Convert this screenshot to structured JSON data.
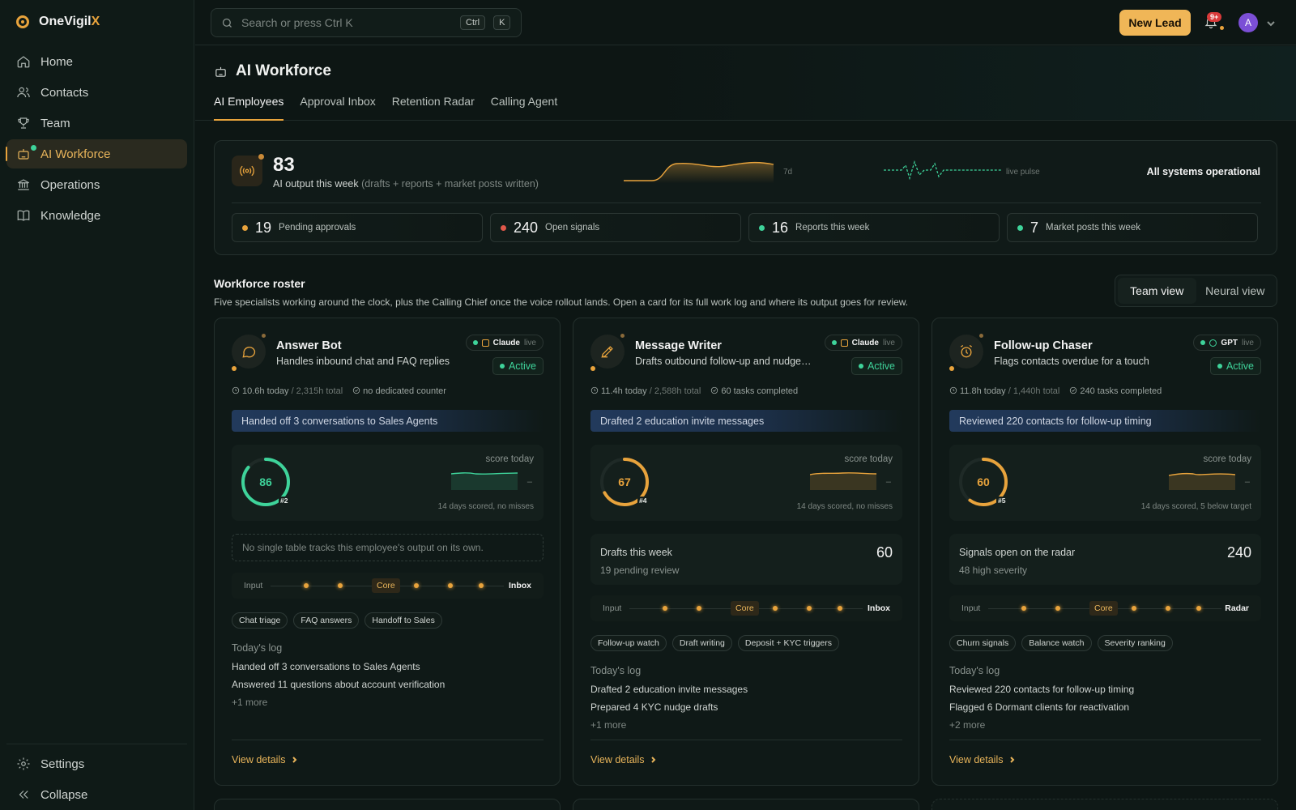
{
  "brand": {
    "name": "OneVigil",
    "suffix": "X",
    "accent": "#e8a33c"
  },
  "sidebar": {
    "items": [
      {
        "label": "Home",
        "icon": "home-icon"
      },
      {
        "label": "Contacts",
        "icon": "users-icon"
      },
      {
        "label": "Team",
        "icon": "trophy-icon"
      },
      {
        "label": "AI Workforce",
        "icon": "robot-icon",
        "active": true
      },
      {
        "label": "Operations",
        "icon": "bank-icon"
      },
      {
        "label": "Knowledge",
        "icon": "book-icon"
      }
    ],
    "bottom": [
      {
        "label": "Settings",
        "icon": "gear-icon"
      },
      {
        "label": "Collapse",
        "icon": "collapse-icon"
      }
    ]
  },
  "topbar": {
    "search_placeholder": "Search or press Ctrl K",
    "kbd1": "Ctrl",
    "kbd2": "K",
    "new_lead": "New Lead",
    "notif_badge": "9+",
    "avatar": "A"
  },
  "page": {
    "title": "AI Workforce",
    "tabs": [
      "AI Employees",
      "Approval Inbox",
      "Retention Radar",
      "Calling Agent"
    ],
    "active_tab": 0
  },
  "stats": {
    "output_value": "83",
    "output_label": "AI output this week",
    "output_note": "(drafts + reports + market posts written)",
    "spark_label": "7d",
    "pulse_label": "live pulse",
    "status": "All systems operational",
    "minis": [
      {
        "value": "19",
        "label": "Pending approvals",
        "color": "#e8a33c"
      },
      {
        "value": "240",
        "label": "Open signals",
        "color": "#e0584a"
      },
      {
        "value": "16",
        "label": "Reports this week",
        "color": "#3ed39a"
      },
      {
        "value": "7",
        "label": "Market posts this week",
        "color": "#3ed39a"
      }
    ]
  },
  "roster": {
    "title": "Workforce roster",
    "subtitle": "Five specialists working around the clock, plus the Calling Chief once the voice rollout lands. Open a card for its full work log and where its output goes for review.",
    "views": [
      "Team view",
      "Neural view"
    ]
  },
  "cards": [
    {
      "name": "Answer Bot",
      "desc": "Handles inbound chat and FAQ replies",
      "icon": "chat-icon",
      "model": "Claude",
      "live": "live",
      "status": "Active",
      "hours": "10.6h today",
      "total": "/ 2,315h total",
      "counter": "no dedicated counter",
      "banner": "Handed off 3 conversations to Sales Agents",
      "score": 86,
      "rank": "#2",
      "score_color": "#3ed39a",
      "score_label": "score today",
      "dash": "–",
      "score_note": "14 days scored, no misses",
      "note": "No single table tracks this employee's output on its own.",
      "flow_in": "Input",
      "flow_core": "Core",
      "flow_out": "Inbox",
      "tags": [
        "Chat triage",
        "FAQ answers",
        "Handoff to Sales"
      ],
      "log_title": "Today's log",
      "log": [
        "Handed off 3 conversations to Sales Agents",
        "Answered 11 questions about account verification"
      ],
      "more": "+1 more",
      "details": "View details"
    },
    {
      "name": "Message Writer",
      "desc": "Drafts outbound follow-up and nudge messages",
      "icon": "pen-icon",
      "model": "Claude",
      "live": "live",
      "status": "Active",
      "hours": "11.4h today",
      "total": "/ 2,588h total",
      "counter": "60 tasks completed",
      "banner": "Drafted 2 education invite messages",
      "score": 67,
      "rank": "#4",
      "score_color": "#e8a33c",
      "score_label": "score today",
      "dash": "–",
      "score_note": "14 days scored, no misses",
      "info_label": "Drafts this week",
      "info_sub": "19 pending review",
      "info_value": "60",
      "flow_in": "Input",
      "flow_core": "Core",
      "flow_out": "Inbox",
      "tags": [
        "Follow-up watch",
        "Draft writing",
        "Deposit + KYC triggers"
      ],
      "log_title": "Today's log",
      "log": [
        "Drafted 2 education invite messages",
        "Prepared 4 KYC nudge drafts"
      ],
      "more": "+1 more",
      "details": "View details"
    },
    {
      "name": "Follow-up Chaser",
      "desc": "Flags contacts overdue for a touch",
      "icon": "alarm-icon",
      "model": "GPT",
      "live": "live",
      "status": "Active",
      "hours": "11.8h today",
      "total": "/ 1,440h total",
      "counter": "240 tasks completed",
      "banner": "Reviewed 220 contacts for follow-up timing",
      "score": 60,
      "rank": "#5",
      "score_color": "#e8a33c",
      "score_label": "score today",
      "dash": "–",
      "score_note": "14 days scored, 5 below target",
      "info_label": "Signals open on the radar",
      "info_sub": "48 high severity",
      "info_value": "240",
      "flow_in": "Input",
      "flow_core": "Core",
      "flow_out": "Radar",
      "tags": [
        "Churn signals",
        "Balance watch",
        "Severity ranking"
      ],
      "log_title": "Today's log",
      "log": [
        "Reviewed 220 contacts for follow-up timing",
        "Flagged 6 Dormant clients for reactivation"
      ],
      "more": "+2 more",
      "details": "View details"
    }
  ]
}
